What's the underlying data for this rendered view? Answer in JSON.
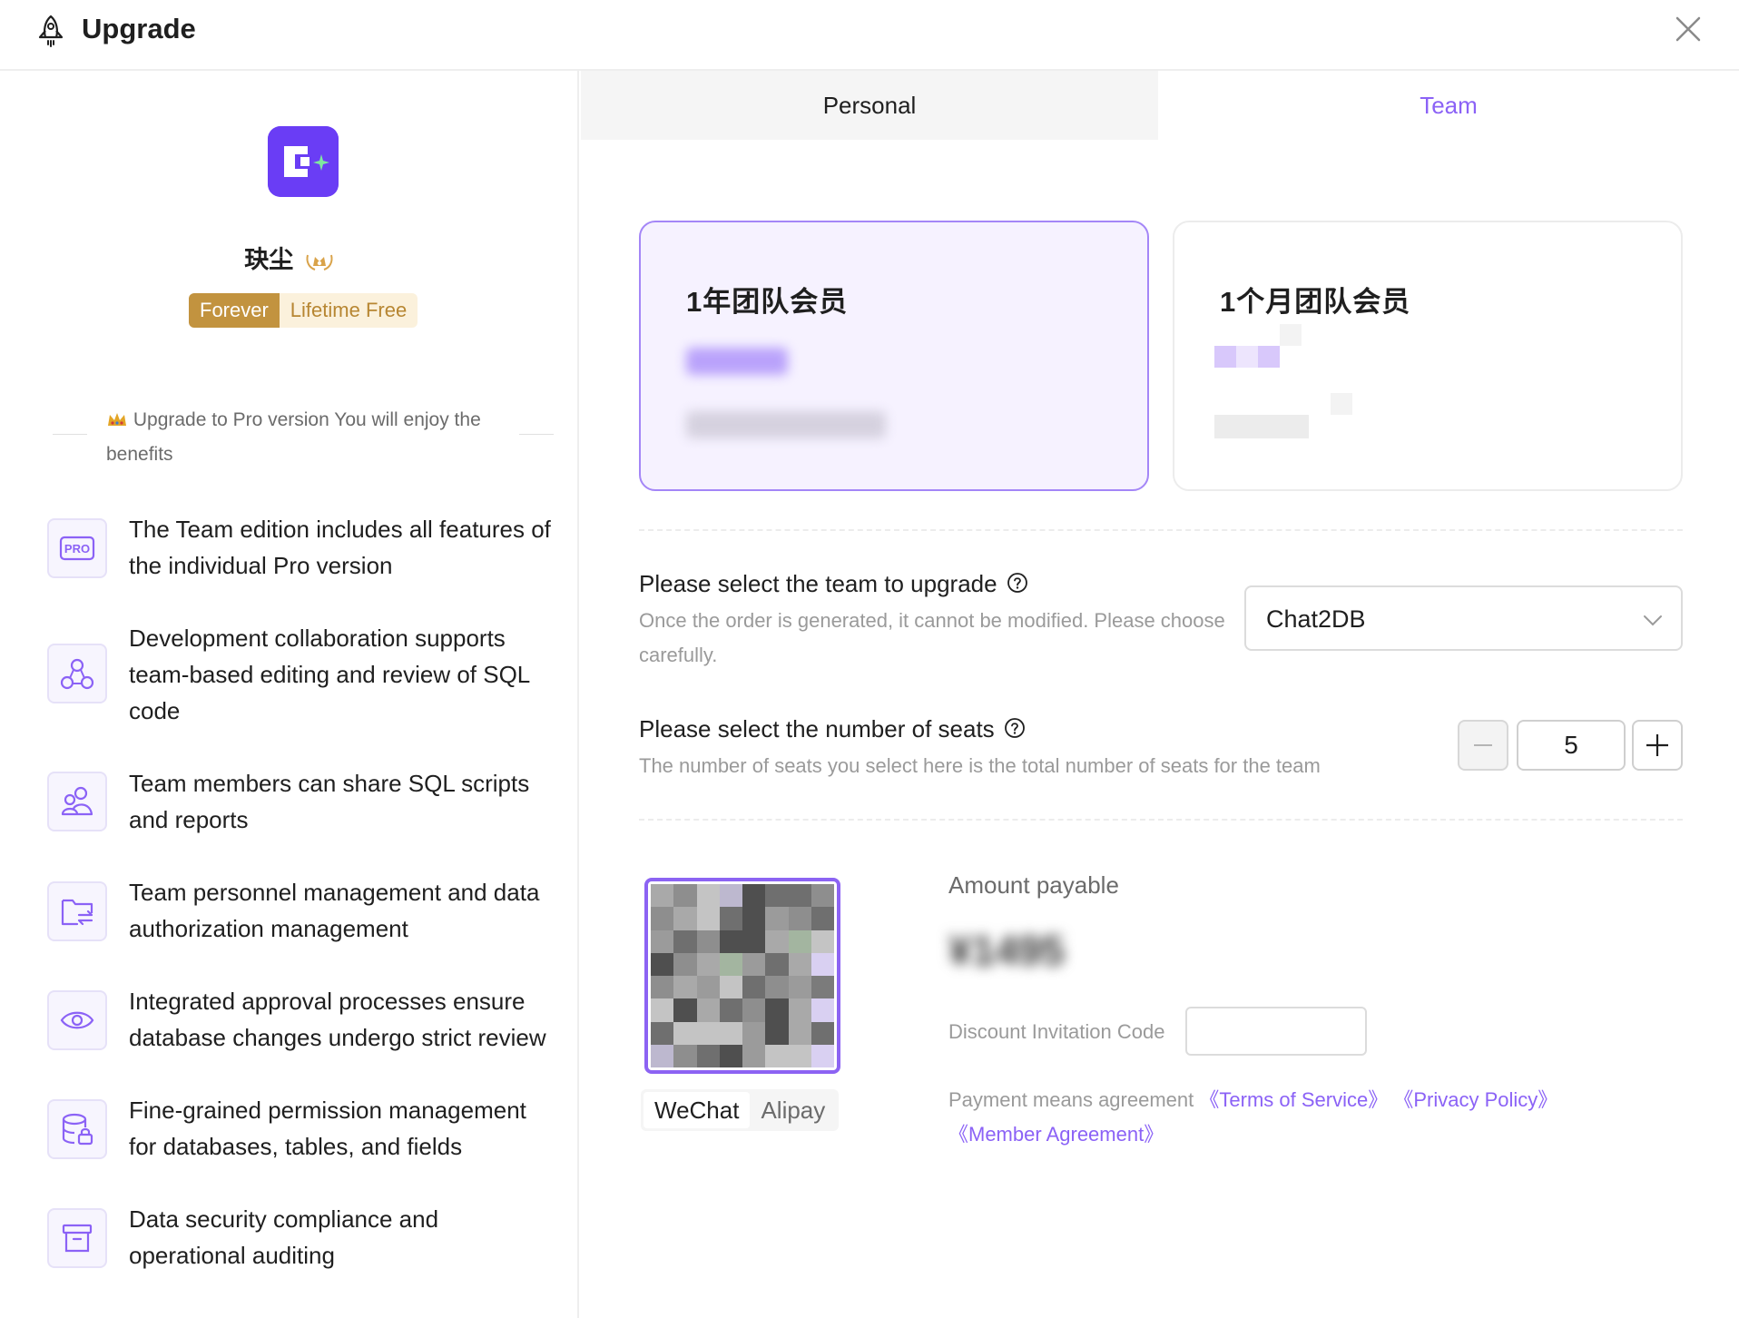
{
  "header": {
    "title": "Upgrade"
  },
  "profile": {
    "name": "玦尘",
    "badge_left": "Forever",
    "badge_right": "Lifetime Free"
  },
  "benefits": {
    "intro": "Upgrade to Pro version You will enjoy the benefits",
    "items": [
      {
        "icon": "pro-icon",
        "text": "The Team edition includes all features of the individual Pro version"
      },
      {
        "icon": "collaboration-icon",
        "text": "Development collaboration supports team-based editing and review of SQL code"
      },
      {
        "icon": "team-members-icon",
        "text": "Team members can share SQL scripts and reports"
      },
      {
        "icon": "folder-transfer-icon",
        "text": "Team personnel management and data authorization management"
      },
      {
        "icon": "eye-icon",
        "text": "Integrated approval processes ensure database changes undergo strict review"
      },
      {
        "icon": "database-lock-icon",
        "text": "Fine-grained permission management for databases, tables, and fields"
      },
      {
        "icon": "archive-box-icon",
        "text": "Data security compliance and operational auditing"
      }
    ]
  },
  "tabs": {
    "personal": "Personal",
    "team": "Team",
    "active": "team"
  },
  "plans": [
    {
      "name": "1年团队会员",
      "selected": true
    },
    {
      "name": "1个月团队会员",
      "selected": false
    }
  ],
  "team_select": {
    "title": "Please select the team to upgrade",
    "subtitle": "Once the order is generated, it cannot be modified. Please choose carefully.",
    "value": "Chat2DB"
  },
  "seats": {
    "title": "Please select the number of seats",
    "subtitle": "The number of seats you select here is the total number of seats for the team",
    "value": "5"
  },
  "payment": {
    "methods": [
      "WeChat",
      "Alipay"
    ],
    "active_method": "WeChat",
    "amount_label": "Amount payable",
    "amount_value": "¥1495",
    "discount_label": "Discount Invitation Code",
    "discount_placeholder": "",
    "agreement_prefix": "Payment means agreement",
    "terms": "《Terms of Service》",
    "privacy": "《Privacy Policy》",
    "member": "《Member Agreement》"
  },
  "colors": {
    "accent": "#8b62f6",
    "logo": "#6a3df5",
    "badge_gold": "#c2933f"
  }
}
